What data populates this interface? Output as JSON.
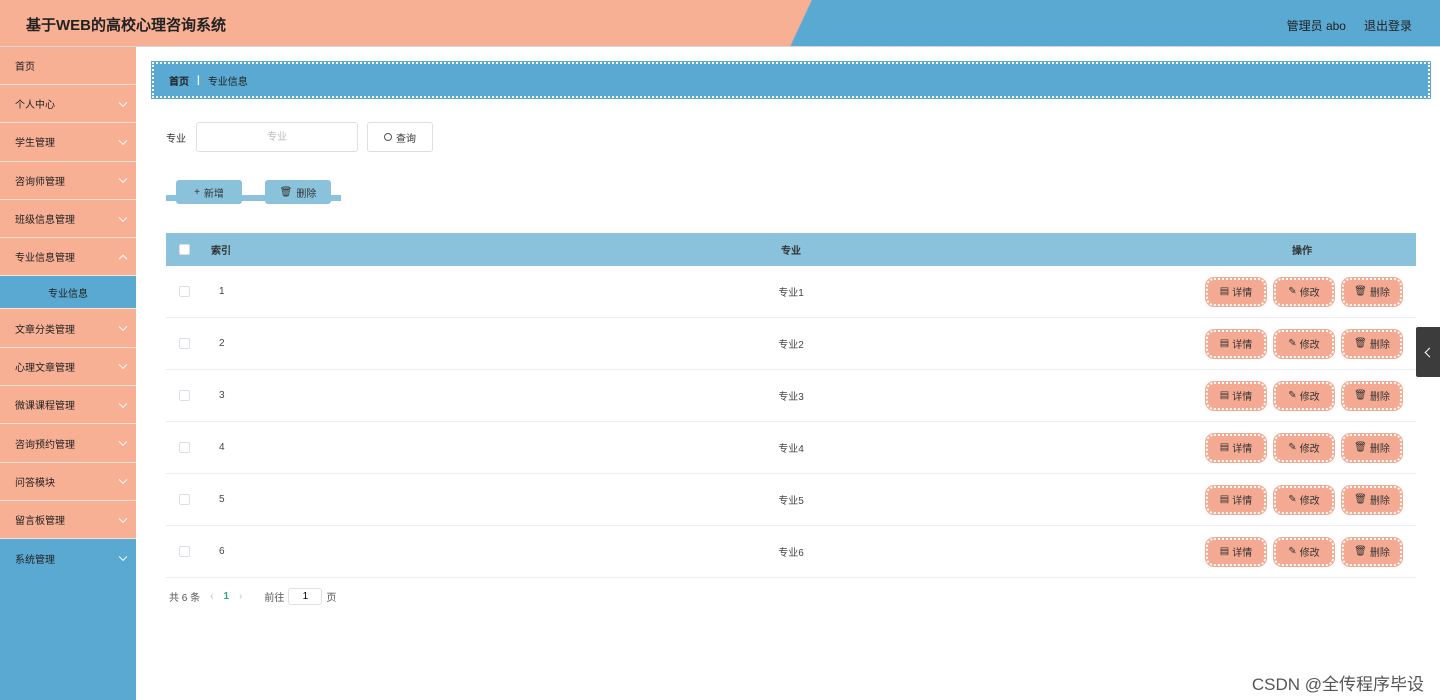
{
  "header": {
    "title": "基于WEB的高校心理咨询系统",
    "user": "管理员 abo",
    "logout": "退出登录"
  },
  "sidebar": {
    "home": "首页",
    "items": [
      {
        "label": "个人中心"
      },
      {
        "label": "学生管理"
      },
      {
        "label": "咨询师管理"
      },
      {
        "label": "班级信息管理"
      },
      {
        "label": "专业信息管理"
      }
    ],
    "active_sub": "专业信息",
    "items2": [
      {
        "label": "文章分类管理"
      },
      {
        "label": "心理文章管理"
      },
      {
        "label": "微课课程管理"
      },
      {
        "label": "咨询预约管理"
      },
      {
        "label": "问答模块"
      },
      {
        "label": "留言板管理"
      },
      {
        "label": "系统管理"
      }
    ]
  },
  "breadcrumb": {
    "home": "首页",
    "sep": "|",
    "current": "专业信息"
  },
  "search": {
    "label": "专业",
    "placeholder": "专业",
    "button": "查询"
  },
  "toolbar": {
    "add": "新增",
    "delete": "删除"
  },
  "table": {
    "headers": {
      "index": "索引",
      "major": "专业",
      "ops": "操作"
    },
    "rows": [
      {
        "index": "1",
        "major": "专业1"
      },
      {
        "index": "2",
        "major": "专业2"
      },
      {
        "index": "3",
        "major": "专业3"
      },
      {
        "index": "4",
        "major": "专业4"
      },
      {
        "index": "5",
        "major": "专业5"
      },
      {
        "index": "6",
        "major": "专业6"
      }
    ],
    "op_labels": {
      "detail": "详情",
      "edit": "修改",
      "delete": "删除"
    }
  },
  "pagination": {
    "total": "共 6 条",
    "current": "1",
    "goto": "前往",
    "page_value": "1",
    "page_suffix": "页"
  },
  "watermark": "CSDN @全传程序毕设",
  "colors": {
    "salmon": "#f8b095",
    "blue": "#5aa9d2",
    "light_blue": "#89c2da",
    "button_salmon": "#f4aa92"
  }
}
